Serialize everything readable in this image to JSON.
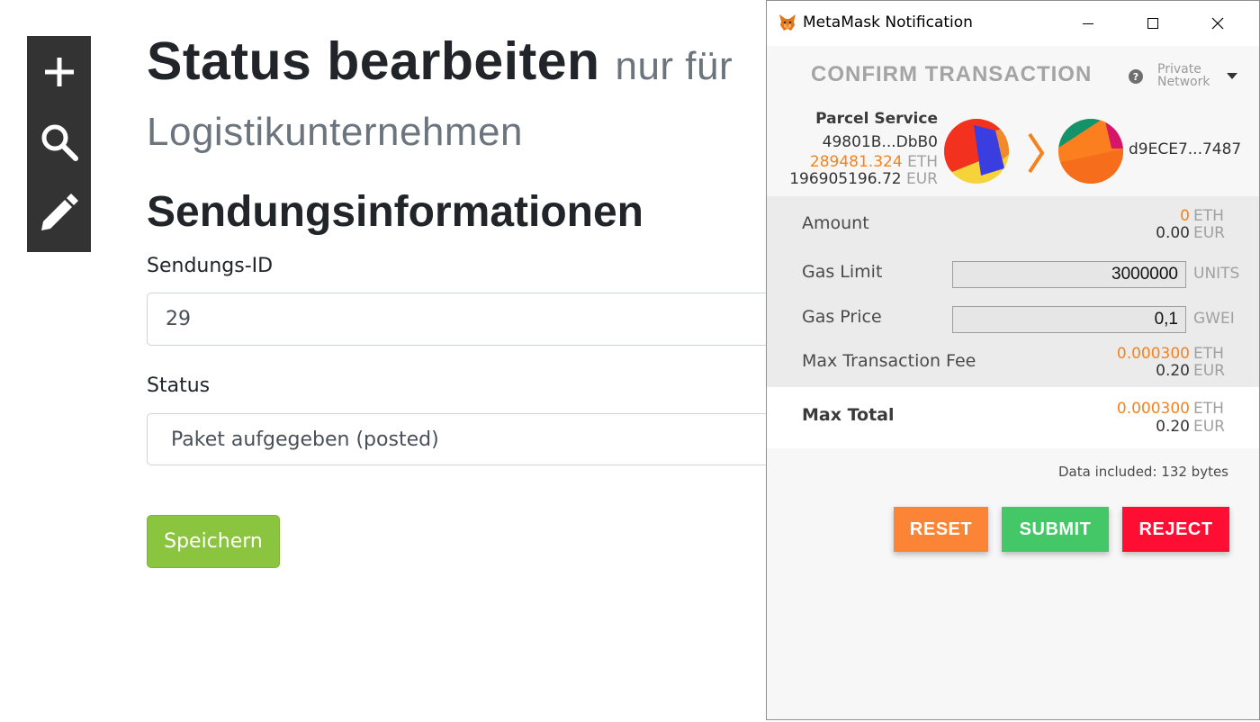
{
  "colors": {
    "toolbar_bg": "#333333",
    "save_button": "#8bc53f",
    "metamask_orange": "#f6821f",
    "reset_button": "#fb8437",
    "submit_button": "#44c767",
    "reject_button": "#ff0e33"
  },
  "toolbar": {
    "items": [
      {
        "icon": "plus-icon"
      },
      {
        "icon": "search-icon"
      },
      {
        "icon": "pencil-icon"
      }
    ]
  },
  "page": {
    "title": "Status bearbeiten",
    "subtitle_1": "nur für",
    "subtitle_2": "Logistikunternehmen",
    "section_title": "Sendungsinformationen",
    "shipment_id_label": "Sendungs-ID",
    "shipment_id_value": "29",
    "status_label": "Status",
    "status_value": "Paket aufgegeben (posted)",
    "save_label": "Speichern"
  },
  "metamask": {
    "window_title": "MetaMask Notification",
    "window_controls": {
      "minimize": "minimize-icon",
      "maximize": "maximize-icon",
      "close": "close-icon"
    },
    "heading": "CONFIRM TRANSACTION",
    "help_glyph": "?",
    "network_line1": "Private",
    "network_line2": "Network",
    "sender": {
      "name": "Parcel Service",
      "address": "49801B...DbB0",
      "balance_eth": "289481.324",
      "balance_eth_unit": "ETH",
      "balance_eur": "196905196.72",
      "balance_eur_unit": "EUR"
    },
    "recipient": {
      "address": "d9ECE7...7487"
    },
    "amount": {
      "label": "Amount",
      "eth": "0",
      "eth_unit": "ETH",
      "eur": "0.00",
      "eur_unit": "EUR"
    },
    "gas_limit": {
      "label": "Gas Limit",
      "value": "3000000",
      "unit": "UNITS"
    },
    "gas_price": {
      "label": "Gas Price",
      "value": "0,1",
      "unit": "GWEI"
    },
    "max_fee": {
      "label": "Max Transaction Fee",
      "eth": "0.000300",
      "eth_unit": "ETH",
      "eur": "0.20",
      "eur_unit": "EUR"
    },
    "max_total": {
      "label": "Max Total",
      "eth": "0.000300",
      "eth_unit": "ETH",
      "eur": "0.20",
      "eur_unit": "EUR"
    },
    "data_included": "Data included: 132 bytes",
    "buttons": {
      "reset": "RESET",
      "submit": "SUBMIT",
      "reject": "REJECT"
    }
  }
}
